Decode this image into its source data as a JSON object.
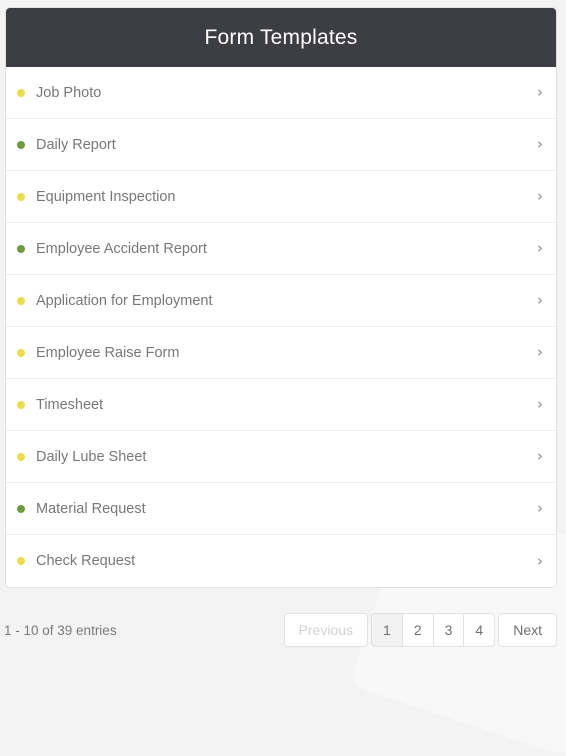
{
  "card": {
    "title": "Form Templates"
  },
  "colors": {
    "header_bg": "#3d3d44",
    "dot_yellow": "#e8de4a",
    "dot_green": "#6d9b3e",
    "text": "#78787c",
    "page_bg": "#f3f3f3",
    "active_page_bg": "#f2f2f2"
  },
  "list": {
    "items": [
      {
        "label": "Job Photo",
        "dot": "#e8de4a",
        "chevron": "›"
      },
      {
        "label": "Daily Report",
        "dot": "#6d9b3e",
        "chevron": "›"
      },
      {
        "label": "Equipment Inspection",
        "dot": "#e8de4a",
        "chevron": "›"
      },
      {
        "label": "Employee Accident Report",
        "dot": "#6d9b3e",
        "chevron": "›"
      },
      {
        "label": "Application for Employment",
        "dot": "#e8de4a",
        "chevron": "›"
      },
      {
        "label": "Employee Raise Form",
        "dot": "#e8de4a",
        "chevron": "›"
      },
      {
        "label": "Timesheet",
        "dot": "#e8de4a",
        "chevron": "›"
      },
      {
        "label": "Daily Lube Sheet",
        "dot": "#e8de4a",
        "chevron": "›"
      },
      {
        "label": "Material Request",
        "dot": "#6d9b3e",
        "chevron": "›"
      },
      {
        "label": "Check Request",
        "dot": "#e8de4a",
        "chevron": "›"
      }
    ]
  },
  "footer": {
    "entries_info": "1 - 10 of 39 entries",
    "pagination": {
      "previous_label": "Previous",
      "previous_disabled": true,
      "pages": [
        "1",
        "2",
        "3",
        "4"
      ],
      "active_page": "1",
      "next_label": "Next"
    }
  }
}
